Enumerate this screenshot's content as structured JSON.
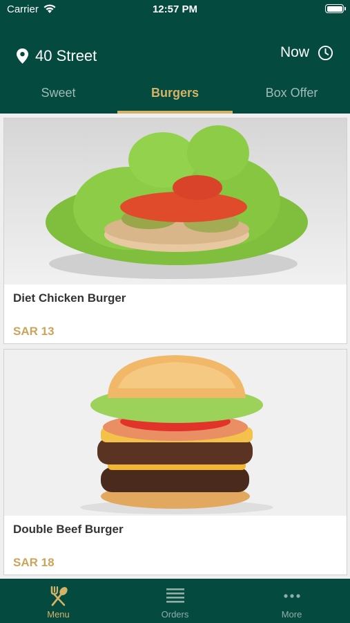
{
  "status": {
    "carrier": "Carrier",
    "time": "12:57 PM"
  },
  "header": {
    "location": "40 Street",
    "time_option": "Now"
  },
  "tabs": [
    {
      "label": "Sweet",
      "active": false
    },
    {
      "label": "Burgers",
      "active": true
    },
    {
      "label": "Box Offer",
      "active": false
    }
  ],
  "items": [
    {
      "name": "Diet Chicken Burger",
      "price": "SAR 13"
    },
    {
      "name": "Double Beef Burger",
      "price": "SAR 18"
    }
  ],
  "nav": [
    {
      "label": "Menu",
      "icon": "fork-spoon-icon",
      "active": true
    },
    {
      "label": "Orders",
      "icon": "list-icon",
      "active": false
    },
    {
      "label": "More",
      "icon": "more-dots-icon",
      "active": false
    }
  ],
  "colors": {
    "primary": "#044a3f",
    "accent": "#d4b368",
    "price": "#cca35b"
  }
}
